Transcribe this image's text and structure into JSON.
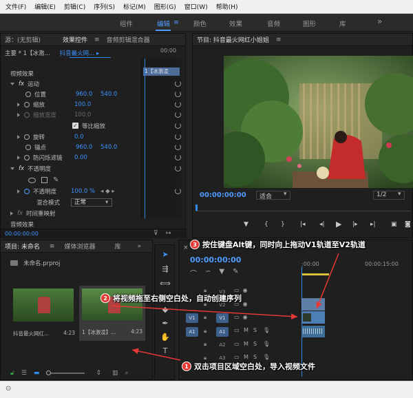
{
  "menu": [
    "文件(F)",
    "编辑(E)",
    "剪辑(C)",
    "序列(S)",
    "标记(M)",
    "图形(G)",
    "窗口(W)",
    "帮助(H)"
  ],
  "workspaces": [
    "组件",
    "编辑",
    "颜色",
    "效果",
    "音频",
    "图形",
    "库"
  ],
  "overflow": "»",
  "effect_panel": {
    "tab_source": "源：(无剪辑)",
    "tab_effect": "效果控件",
    "tab_audio": "音频剪辑混合器",
    "clip_master": "主要 * 1【冰激...",
    "clip_seq": "抖音最火网... ▸",
    "mini_clip": "1【冰激凌",
    "timecode_head": "00:00",
    "section_video": "视频效果",
    "motion": "运动",
    "position": "位置",
    "position_x": "960.0",
    "position_y": "540.0",
    "scale": "缩放",
    "scale_val": "100.0",
    "scale_w": "缩放宽度",
    "scale_w_val": "100.0",
    "uniform": "等比缩放",
    "rotation": "旋转",
    "rotation_val": "0.0",
    "anchor": "锚点",
    "anchor_x": "960.0",
    "anchor_y": "540.0",
    "antiflicker": "防闪烁滤镜",
    "antiflicker_val": "0.00",
    "opacity_section": "不透明度",
    "opacity": "不透明度",
    "opacity_val": "100.0 %",
    "blend": "混合模式",
    "blend_val": "正常",
    "time_remap": "时间重映射",
    "section_audio": "音频效果",
    "timecode": "00:00:00:00"
  },
  "program": {
    "title": "节目: 抖音最火网红小姐姐",
    "timecode": "00:00:00:00",
    "fit": "适合",
    "ratio": "1/2"
  },
  "project": {
    "tab_project": "项目: 未命名",
    "tab_media": "媒体浏览器",
    "tab_lib": "库",
    "file": "未命名.prproj",
    "clips": [
      {
        "name": "抖音最火网红...",
        "duration": "4:23"
      },
      {
        "name": "1【冰激凌】...",
        "duration": "4:23"
      }
    ]
  },
  "timeline": {
    "timecode": "00:00:00:00",
    "ruler_start": ":00:00",
    "ruler_mid": "00:00:15:00",
    "tracks": [
      "V3",
      "V2",
      "V1",
      "A1",
      "A2",
      "A3"
    ],
    "src_v": "V1",
    "src_a": "A1",
    "track_m": "M",
    "track_s": "S"
  },
  "callouts": {
    "c1_num": "1",
    "c1": "双击项目区域空白处，导入视频文件",
    "c2_num": "2",
    "c2": "将视频拖至右侧空白处，自动创建序列",
    "c3_num": "3",
    "c3": "按住键盘Alt键，同时向上拖动V1轨道至V2轨道"
  },
  "colors": {
    "accent": "#2d8ceb",
    "callout": "#e53935",
    "clip": "#4d7fb6",
    "audio_clip": "#3f6e98"
  }
}
